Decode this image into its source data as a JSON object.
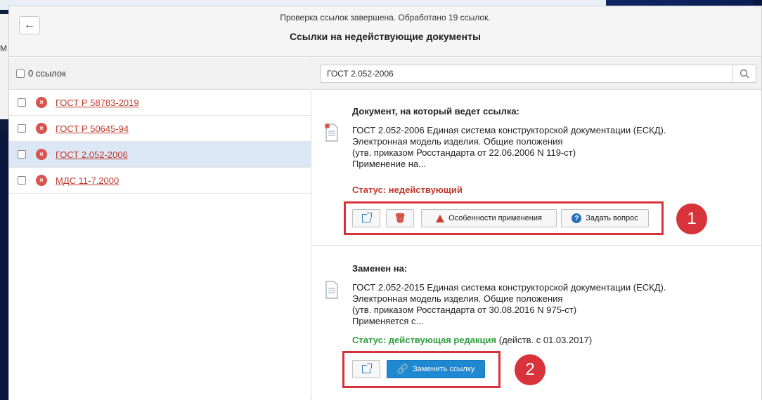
{
  "background": {
    "side_text": "М"
  },
  "header": {
    "back_icon": "arrow-left-icon",
    "status": "Проверка ссылок завершена. Обработано 19 ссылок.",
    "title": "Ссылки на недействующие документы"
  },
  "left": {
    "select_all_label": "0 ссылок",
    "items": [
      {
        "label": "ГОСТ Р 58783-2019",
        "selected": false
      },
      {
        "label": "ГОСТ Р 50645-94",
        "selected": false
      },
      {
        "label": "ГОСТ 2.052-2006",
        "selected": true
      },
      {
        "label": "МДС 11-7.2000",
        "selected": false
      }
    ],
    "error_icon_glyph": "×"
  },
  "search": {
    "value": "ГОСТ 2.052-2006",
    "icon": "search-icon"
  },
  "target_doc": {
    "heading": "Документ, на который ведет ссылка:",
    "lines": [
      "ГОСТ 2.052-2006 Единая система конструкторской документации (ЕСКД).",
      "Электронная модель изделия. Общие положения",
      "(утв. приказом Росстандарта от 22.06.2006 N 119-ст)",
      "Применение на..."
    ],
    "status": "Статус: недействующий",
    "buttons": {
      "features": "Особенности применения",
      "ask": "Задать вопрос"
    }
  },
  "replacement": {
    "heading": "Заменен на:",
    "lines": [
      "ГОСТ 2.052-2015 Единая система конструкторской документации (ЕСКД).",
      "Электронная модель изделия. Общие положения",
      "(утв. приказом Росстандарта от 30.08.2016 N 975-ст)",
      "Применяется с..."
    ],
    "status_label": "Статус: действующая редакция",
    "status_note": "(действ. с 01.03.2017)",
    "buttons": {
      "replace": "Заменить ссылку"
    }
  },
  "annotations": {
    "badge1": "1",
    "badge2": "2"
  },
  "colors": {
    "accent_red": "#d8323a",
    "primary_blue": "#1e88d2",
    "status_green": "#2e9e3e",
    "status_red": "#c0392b"
  }
}
